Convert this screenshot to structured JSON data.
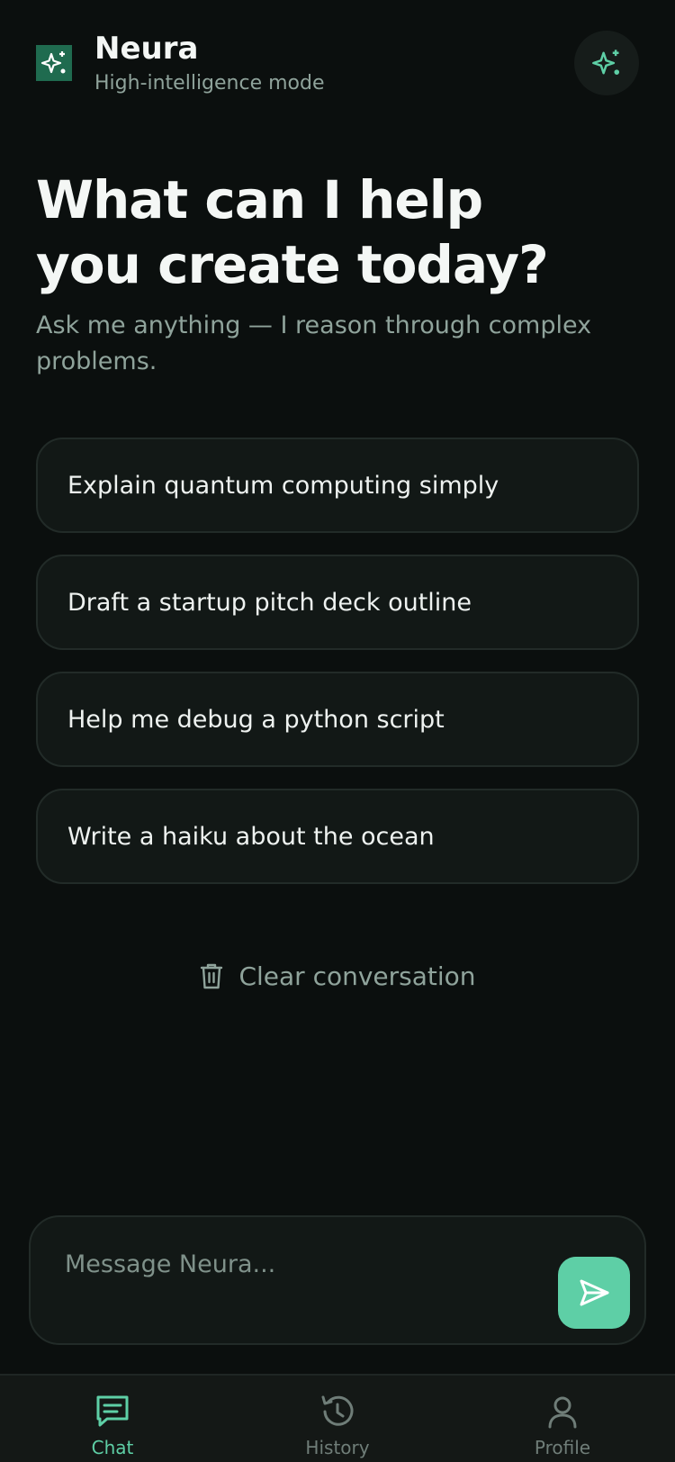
{
  "header": {
    "app_name": "Neura",
    "mode": "High-intelligence mode",
    "logo_icon": "sparkle-icon",
    "action_icon": "sparkle-icon"
  },
  "hero": {
    "title_line1": "What can I help",
    "title_line2": "you create today?",
    "subtitle": "Ask me anything — I reason through complex problems."
  },
  "suggestions": [
    {
      "label": "Explain quantum computing simply"
    },
    {
      "label": "Draft a startup pitch deck outline"
    },
    {
      "label": "Help me debug a python script"
    },
    {
      "label": "Write a haiku about the ocean"
    }
  ],
  "clear": {
    "label": "Clear conversation",
    "icon": "trash-icon"
  },
  "composer": {
    "placeholder": "Message Neura...",
    "value": "",
    "send_icon": "send-icon"
  },
  "nav": {
    "items": [
      {
        "label": "Chat",
        "icon": "chat-icon",
        "active": true
      },
      {
        "label": "History",
        "icon": "history-icon",
        "active": false
      },
      {
        "label": "Profile",
        "icon": "profile-icon",
        "active": false
      }
    ]
  },
  "colors": {
    "background": "#0b0f0e",
    "accent": "#5ecfa6",
    "card": "#121816",
    "muted_text": "#8fa39b"
  }
}
